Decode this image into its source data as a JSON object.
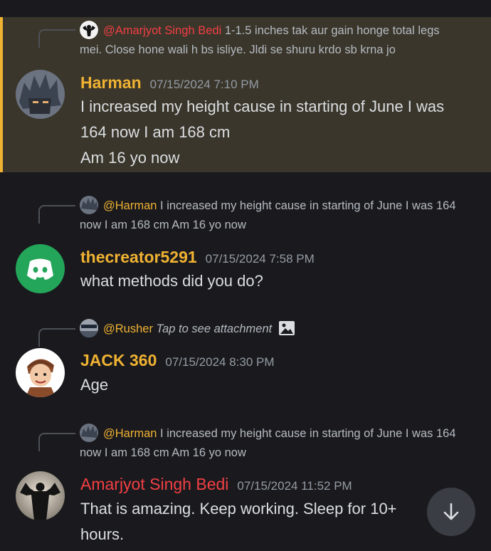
{
  "messages": [
    {
      "reply_mention": "@Amarjyot Singh Bedi",
      "reply_text": "1-1.5 inches tak aur gain honge total legs mei. Close hone wali h bs isliye. Jldi se shuru krdo sb krna jo",
      "username": "Harman",
      "timestamp": "07/15/2024 7:10 PM",
      "lines": [
        "I increased my height cause in starting of June I was 164 now I am 168 cm",
        "Am 16 yo now"
      ]
    },
    {
      "reply_mention": "@Harman",
      "reply_text": "I increased my height cause in starting of June I was 164 now I am 168 cm  Am 16 yo now",
      "username": "thecreator5291",
      "timestamp": "07/15/2024 7:58 PM",
      "lines": [
        "what methods did you do?"
      ]
    },
    {
      "reply_mention": "@Rusher",
      "reply_text": "Tap to see attachment",
      "username": "JACK 360",
      "timestamp": "07/15/2024 8:30 PM",
      "lines": [
        "Age"
      ]
    },
    {
      "reply_mention": "@Harman",
      "reply_text": "I increased my height cause in starting of June I was 164 now I am 168 cm  Am 16 yo now",
      "username": "Amarjyot Singh Bedi",
      "timestamp": "07/15/2024 11:52 PM",
      "lines": [
        "That is amazing. Keep working. Sleep for 10+ hours."
      ]
    }
  ],
  "colors": {
    "background": "#1a1a1e",
    "highlight_bg": "#3a362b",
    "highlight_border": "#f0b232",
    "username_yellow": "#f0b232",
    "username_red": "#f23f43",
    "discord_green": "#23a55a"
  },
  "icons": {
    "attachment": "image-icon",
    "scroll": "arrow-down-icon"
  }
}
